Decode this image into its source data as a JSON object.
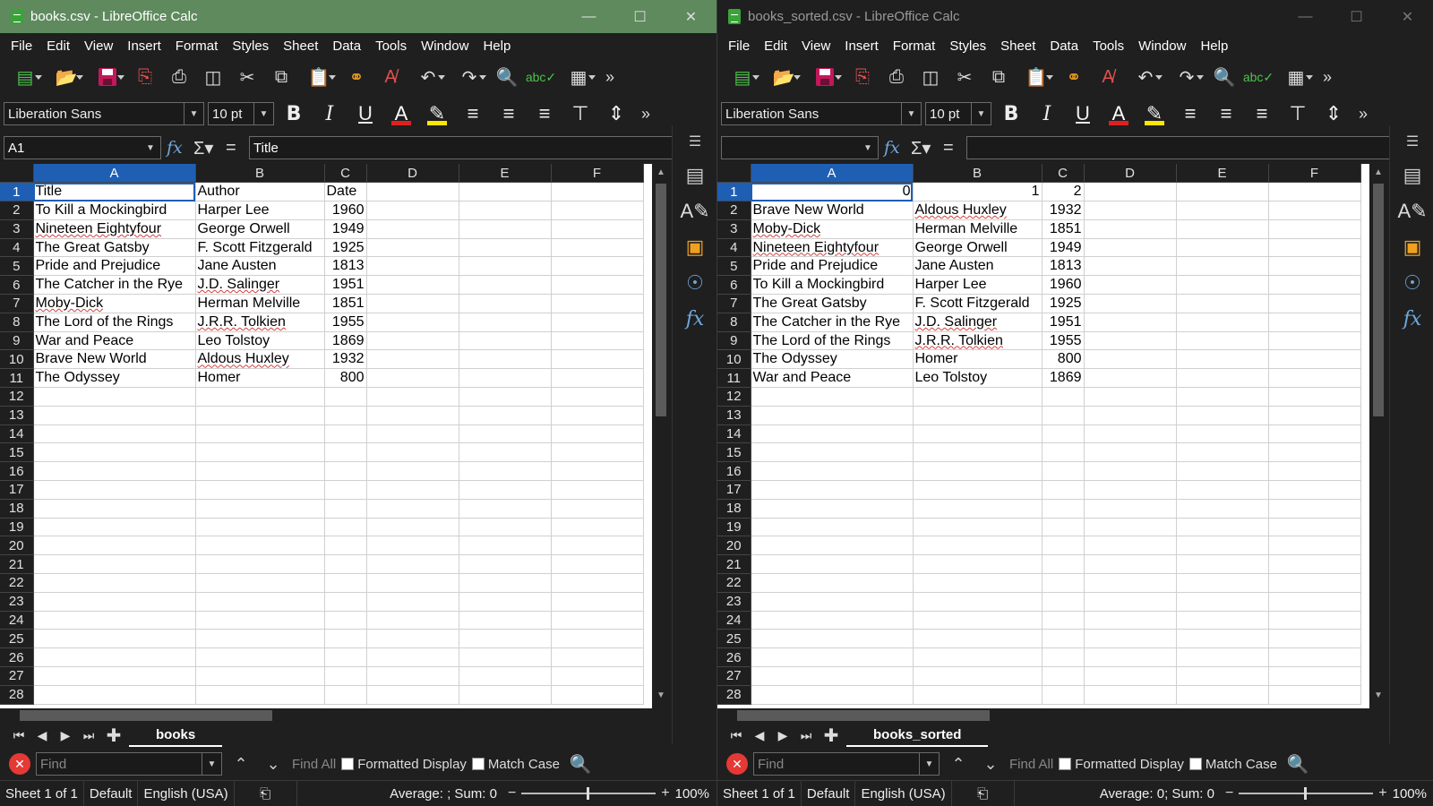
{
  "windows": [
    {
      "title": "books.csv - LibreOffice Calc",
      "menu": [
        "File",
        "Edit",
        "View",
        "Insert",
        "Format",
        "Styles",
        "Sheet",
        "Data",
        "Tools",
        "Window",
        "Help"
      ],
      "font_name": "Liberation Sans",
      "font_size": "10 pt",
      "name_box": "A1",
      "formula": "Title",
      "columns": [
        "A",
        "B",
        "C",
        "D",
        "E",
        "F"
      ],
      "selected_column": "A",
      "row_numbers": [
        "1",
        "2",
        "3",
        "4",
        "5",
        "6",
        "7",
        "8",
        "9",
        "10",
        "11",
        "12",
        "13",
        "14",
        "15",
        "16",
        "17",
        "18",
        "19",
        "20",
        "21",
        "22",
        "23",
        "24",
        "25",
        "26",
        "27",
        "28"
      ],
      "rows": [
        [
          "Title",
          "Author",
          "Date"
        ],
        [
          "To Kill a Mockingbird",
          "Harper Lee",
          "1960"
        ],
        [
          "Nineteen Eightyfour",
          "George Orwell",
          "1949"
        ],
        [
          "The Great Gatsby",
          "F. Scott Fitzgerald",
          "1925"
        ],
        [
          "Pride and Prejudice",
          "Jane Austen",
          "1813"
        ],
        [
          "The Catcher in the Rye",
          "J.D. Salinger",
          "1951"
        ],
        [
          "Moby-Dick",
          "Herman Melville",
          "1851"
        ],
        [
          "The Lord of the Rings",
          "J.R.R. Tolkien",
          "1955"
        ],
        [
          "War and Peace",
          "Leo Tolstoy",
          "1869"
        ],
        [
          "Brave New World",
          "Aldous Huxley",
          "1932"
        ],
        [
          "The Odyssey",
          "Homer",
          "800"
        ]
      ],
      "sheet_tab": "books",
      "find_placeholder": "Find",
      "find_all": "Find All",
      "formatted_display": "Formatted Display",
      "match_case": "Match Case",
      "status": {
        "sheet": "Sheet 1 of 1",
        "style": "Default",
        "language": "English (USA)",
        "sum": "Average: ; Sum: 0",
        "zoom": "100%"
      }
    },
    {
      "title": "books_sorted.csv - LibreOffice Calc",
      "menu": [
        "File",
        "Edit",
        "View",
        "Insert",
        "Format",
        "Styles",
        "Sheet",
        "Data",
        "Tools",
        "Window",
        "Help"
      ],
      "font_name": "Liberation Sans",
      "font_size": "10 pt",
      "name_box": "",
      "formula": "",
      "columns": [
        "A",
        "B",
        "C",
        "D",
        "E",
        "F"
      ],
      "selected_column": "A",
      "row_numbers": [
        "1",
        "2",
        "3",
        "4",
        "5",
        "6",
        "7",
        "8",
        "9",
        "10",
        "11",
        "12",
        "13",
        "14",
        "15",
        "16",
        "17",
        "18",
        "19",
        "20",
        "21",
        "22",
        "23",
        "24",
        "25",
        "26",
        "27",
        "28"
      ],
      "rows": [
        [
          "0",
          "1",
          "2"
        ],
        [
          "Brave New World",
          "Aldous Huxley",
          "1932"
        ],
        [
          "Moby-Dick",
          "Herman Melville",
          "1851"
        ],
        [
          "Nineteen Eightyfour",
          "George Orwell",
          "1949"
        ],
        [
          "Pride and Prejudice",
          "Jane Austen",
          "1813"
        ],
        [
          "To Kill a Mockingbird",
          "Harper Lee",
          "1960"
        ],
        [
          "The Great Gatsby",
          "F. Scott Fitzgerald",
          "1925"
        ],
        [
          "The Catcher in the Rye",
          "J.D. Salinger",
          "1951"
        ],
        [
          "The Lord of the Rings",
          "J.R.R. Tolkien",
          "1955"
        ],
        [
          "The Odyssey",
          "Homer",
          "800"
        ],
        [
          "War and Peace",
          "Leo Tolstoy",
          "1869"
        ]
      ],
      "sheet_tab": "books_sorted",
      "find_placeholder": "Find",
      "find_all": "Find All",
      "formatted_display": "Formatted Display",
      "match_case": "Match Case",
      "status": {
        "sheet": "Sheet 1 of 1",
        "style": "Default",
        "language": "English (USA)",
        "sum": "Average: 0; Sum: 0",
        "zoom": "100%"
      }
    }
  ],
  "icons": {
    "toolbar": [
      "new-document-icon",
      "open-folder-icon",
      "save-icon",
      "export-pdf-icon",
      "print-icon",
      "print-preview-icon",
      "cut-icon",
      "copy-icon",
      "paste-icon",
      "clone-formatting-icon",
      "clear-formatting-icon",
      "undo-icon",
      "redo-icon",
      "find-replace-icon",
      "spellcheck-icon",
      "row-icon",
      "more-icon"
    ],
    "sidebar": [
      "sidebar-menu-icon",
      "properties-icon",
      "styles-icon",
      "gallery-icon",
      "navigator-icon",
      "functions-icon"
    ]
  },
  "colors": {
    "selection": "#1e5fb4",
    "active_title": "#5e8a5e",
    "close_red": "#e53935"
  }
}
